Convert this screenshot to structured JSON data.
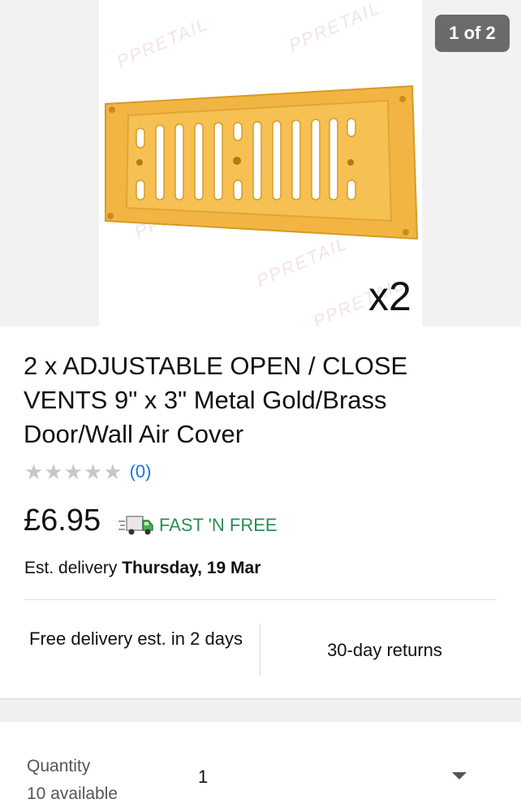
{
  "gallery": {
    "counter": "1 of 2",
    "overlay_label": "x2",
    "watermark": "PPRETAIL"
  },
  "product": {
    "title": "2 x ADJUSTABLE OPEN / CLOSE VENTS 9\" x 3\" Metal Gold/Brass Door/Wall Air Cover",
    "rating_stars": 0,
    "review_count": "(0)",
    "price": "£6.95",
    "shipping_label": "FAST 'N FREE",
    "shipping_icon": "delivery-truck-icon",
    "delivery_prefix": "Est. delivery",
    "delivery_date": "Thursday, 19 Mar"
  },
  "info": {
    "delivery_text": "Free delivery est. in 2 days",
    "returns_text": "30-day returns"
  },
  "quantity": {
    "label": "Quantity",
    "available": "10 available",
    "value": "1"
  },
  "colors": {
    "accent": "#3665f3",
    "link": "#1a73e8",
    "shipping_green": "#2e8b57",
    "vent_gold": "#f2b544"
  }
}
